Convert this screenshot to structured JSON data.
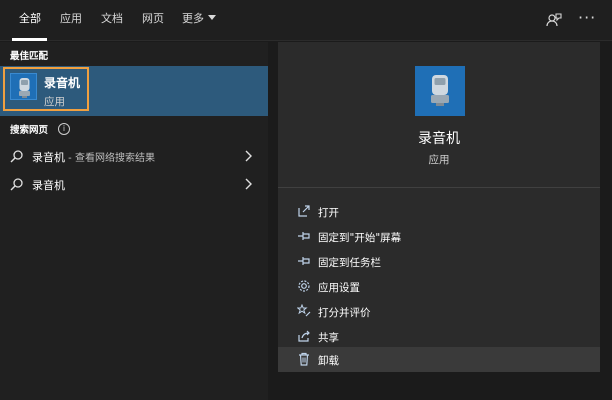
{
  "tabs": {
    "all": "全部",
    "apps": "应用",
    "documents": "文档",
    "web": "网页",
    "more": "更多"
  },
  "top_icons": {
    "feedback": "feedback-icon",
    "more_options": "···"
  },
  "left": {
    "best_match_header": "最佳匹配",
    "best_match": {
      "title": "录音机",
      "subtitle": "应用",
      "icon": "voice-recorder-icon"
    },
    "web_search_header": "搜索网页",
    "web_results": [
      {
        "query": "录音机",
        "hint": " - 查看网络搜索结果"
      },
      {
        "query": "录音机",
        "hint": ""
      }
    ]
  },
  "right": {
    "app_title": "录音机",
    "app_subtitle": "应用",
    "actions": [
      {
        "label": "打开",
        "icon": "open-icon"
      },
      {
        "label": "固定到\"开始\"屏幕",
        "icon": "pin-start-icon"
      },
      {
        "label": "固定到任务栏",
        "icon": "pin-taskbar-icon"
      },
      {
        "label": "应用设置",
        "icon": "gear-icon"
      },
      {
        "label": "打分并评价",
        "icon": "rate-icon"
      },
      {
        "label": "共享",
        "icon": "share-icon"
      },
      {
        "label": "卸载",
        "icon": "trash-icon"
      }
    ]
  },
  "colors": {
    "background": "#1b1b1b",
    "selected_row": "#2d5a7c",
    "focus_border": "#f0a040",
    "app_tile": "#1f6fb6",
    "detail_panel": "#2b2b2b"
  }
}
